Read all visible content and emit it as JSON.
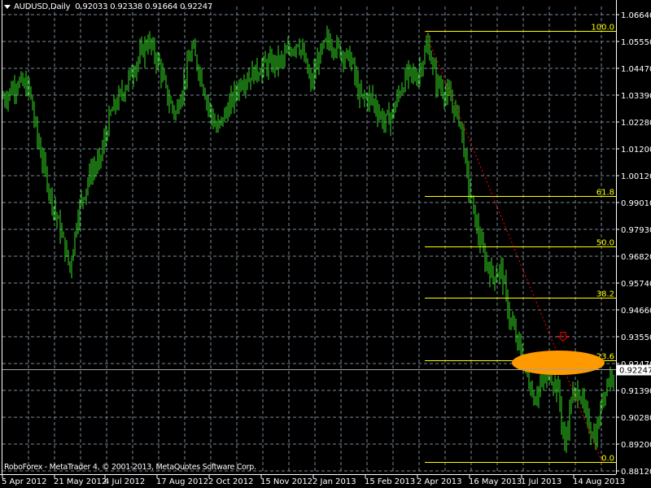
{
  "header": {
    "symbol": "AUDUSD,Daily",
    "open": "0.92033",
    "high": "0.92338",
    "low": "0.91664",
    "close": "0.92247"
  },
  "footer": "RoboForex - MetaTrader 4, © 2001-2013, MetaQuotes Software Corp.",
  "colors": {
    "background": "#000000",
    "bars": "#33dd22",
    "grid": "#778899",
    "fibo": "#ffff00",
    "trend": "#ff0000",
    "highlight": "#ff9900"
  },
  "chart_data": {
    "type": "bar",
    "title": "AUDUSD,Daily",
    "ylim": [
      0.8812,
      1.0664
    ],
    "y_ticks": [
      "1.06640",
      "1.05550",
      "1.04470",
      "1.03390",
      "1.02280",
      "1.01200",
      "1.00120",
      "0.99010",
      "0.97930",
      "0.96820",
      "0.95740",
      "0.94660",
      "0.93550",
      "0.92470",
      "0.91390",
      "0.90280",
      "0.89200",
      "0.88120"
    ],
    "x_ticks": [
      "5 Apr 2012",
      "21 May 2012",
      "4 Jul 2012",
      "17 Aug 2012",
      "2 Oct 2012",
      "15 Nov 2012",
      "2 Jan 2013",
      "15 Feb 2013",
      "2 Apr 2013",
      "16 May 2013",
      "1 Jul 2013",
      "14 Aug 2013"
    ],
    "bar_count": 376,
    "close_path": [
      [
        1,
        1.0327
      ],
      [
        9,
        1.0393
      ],
      [
        16,
        1.036
      ],
      [
        21,
        1.0162
      ],
      [
        29,
        0.9931
      ],
      [
        36,
        0.9766
      ],
      [
        41,
        0.9634
      ],
      [
        46,
        0.9865
      ],
      [
        54,
        1.003
      ],
      [
        59,
        1.0063
      ],
      [
        66,
        1.0261
      ],
      [
        74,
        1.036
      ],
      [
        81,
        1.0459
      ],
      [
        89,
        1.0558
      ],
      [
        96,
        1.0459
      ],
      [
        101,
        1.0327
      ],
      [
        106,
        1.0261
      ],
      [
        111,
        1.0393
      ],
      [
        116,
        1.0525
      ],
      [
        121,
        1.0426
      ],
      [
        126,
        1.0294
      ],
      [
        131,
        1.0195
      ],
      [
        139,
        1.0294
      ],
      [
        146,
        1.0393
      ],
      [
        154,
        1.0426
      ],
      [
        161,
        1.0459
      ],
      [
        171,
        1.0476
      ],
      [
        181,
        1.0558
      ],
      [
        186,
        1.0459
      ],
      [
        189,
        1.0377
      ],
      [
        194,
        1.0492
      ],
      [
        199,
        1.0558
      ],
      [
        206,
        1.0525
      ],
      [
        214,
        1.0476
      ],
      [
        219,
        1.0327
      ],
      [
        226,
        1.0327
      ],
      [
        234,
        1.0228
      ],
      [
        239,
        1.0261
      ],
      [
        244,
        1.036
      ],
      [
        249,
        1.0426
      ],
      [
        254,
        1.041
      ],
      [
        261,
        1.0542
      ],
      [
        266,
        1.0393
      ],
      [
        274,
        1.0327
      ],
      [
        281,
        1.0228
      ],
      [
        286,
        0.9964
      ],
      [
        291,
        0.9799
      ],
      [
        296,
        0.9667
      ],
      [
        301,
        0.9601
      ],
      [
        306,
        0.9634
      ],
      [
        311,
        0.9436
      ],
      [
        319,
        0.9271
      ],
      [
        326,
        0.9106
      ],
      [
        331,
        0.9172
      ],
      [
        336,
        0.9205
      ],
      [
        341,
        0.9139
      ],
      [
        345,
        0.8908
      ],
      [
        349,
        0.9106
      ],
      [
        354,
        0.9139
      ],
      [
        359,
        0.9008
      ],
      [
        364,
        0.8942
      ],
      [
        369,
        0.9139
      ],
      [
        375,
        0.9225
      ]
    ],
    "current_price": "0.92247",
    "current_price_value": 0.92247,
    "fibonacci": {
      "start_bar": 259,
      "price_100": 1.0598,
      "price_0": 0.8847,
      "levels": [
        {
          "label": "100.0",
          "ratio": 1.0
        },
        {
          "label": "61.8",
          "ratio": 0.618
        },
        {
          "label": "50.0",
          "ratio": 0.5
        },
        {
          "label": "38.2",
          "ratio": 0.382
        },
        {
          "label": "23.6",
          "ratio": 0.236
        },
        {
          "label": "0.0",
          "ratio": 0.0
        }
      ]
    },
    "trendline": {
      "from": [
        259,
        1.0598
      ],
      "to": [
        368,
        0.8847
      ]
    },
    "highlight_zone": {
      "center_bar": 341,
      "price": 0.9251
    },
    "arrow_down": {
      "bar": 344,
      "price": 0.9355
    }
  }
}
